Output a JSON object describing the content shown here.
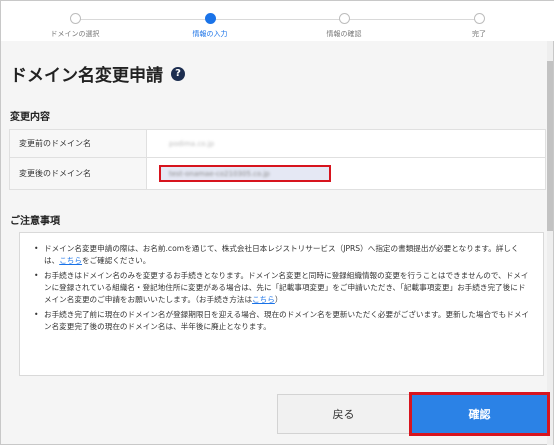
{
  "steps": [
    {
      "label": "ドメインの選択"
    },
    {
      "label": "情報の入力"
    },
    {
      "label": "情報の確認"
    },
    {
      "label": "完了"
    }
  ],
  "header": {
    "title": "ドメイン名変更申請",
    "help_icon": "?"
  },
  "change_section": {
    "title": "変更内容",
    "rows": [
      {
        "label": "変更前のドメイン名",
        "value": "podima.co.jp"
      },
      {
        "label": "変更後のドメイン名",
        "value": "test-onamae-co210305.co.jp"
      }
    ]
  },
  "notes_section": {
    "title": "ご注意事項",
    "items": [
      {
        "text": "ドメイン名変更申請の際は、お名前.comを通じて、株式会社日本レジストリサービス（JPRS）へ指定の書類提出が必要となります。詳しくは、",
        "link": "こちら",
        "tail": "をご確認ください。"
      },
      {
        "text": "お手続きはドメイン名のみを変更するお手続きとなります。ドメイン名変更と同時に登録組織情報の変更を行うことはできませんので、ドメインに登録されている組織名・登記地住所に変更がある場合は、先に「記載事項変更」をご申請いただき、「記載事項変更」お手続き完了後にドメイン名変更のご申請をお願いいたします。（お手続き方法は",
        "link": "こちら",
        "tail": "）"
      },
      {
        "text": "お手続き完了前に現在のドメイン名が登録期限日を迎える場合、現在のドメイン名を更新いただく必要がございます。更新した場合でもドメイン名変更完了後の現在のドメイン名は、半年後に廃止となります。",
        "link": "",
        "tail": ""
      }
    ]
  },
  "buttons": {
    "back": "戻る",
    "confirm": "確認"
  },
  "colors": {
    "accent": "#1a73e8",
    "highlight": "#d7141e",
    "confirm_bg": "#2b82e6"
  }
}
